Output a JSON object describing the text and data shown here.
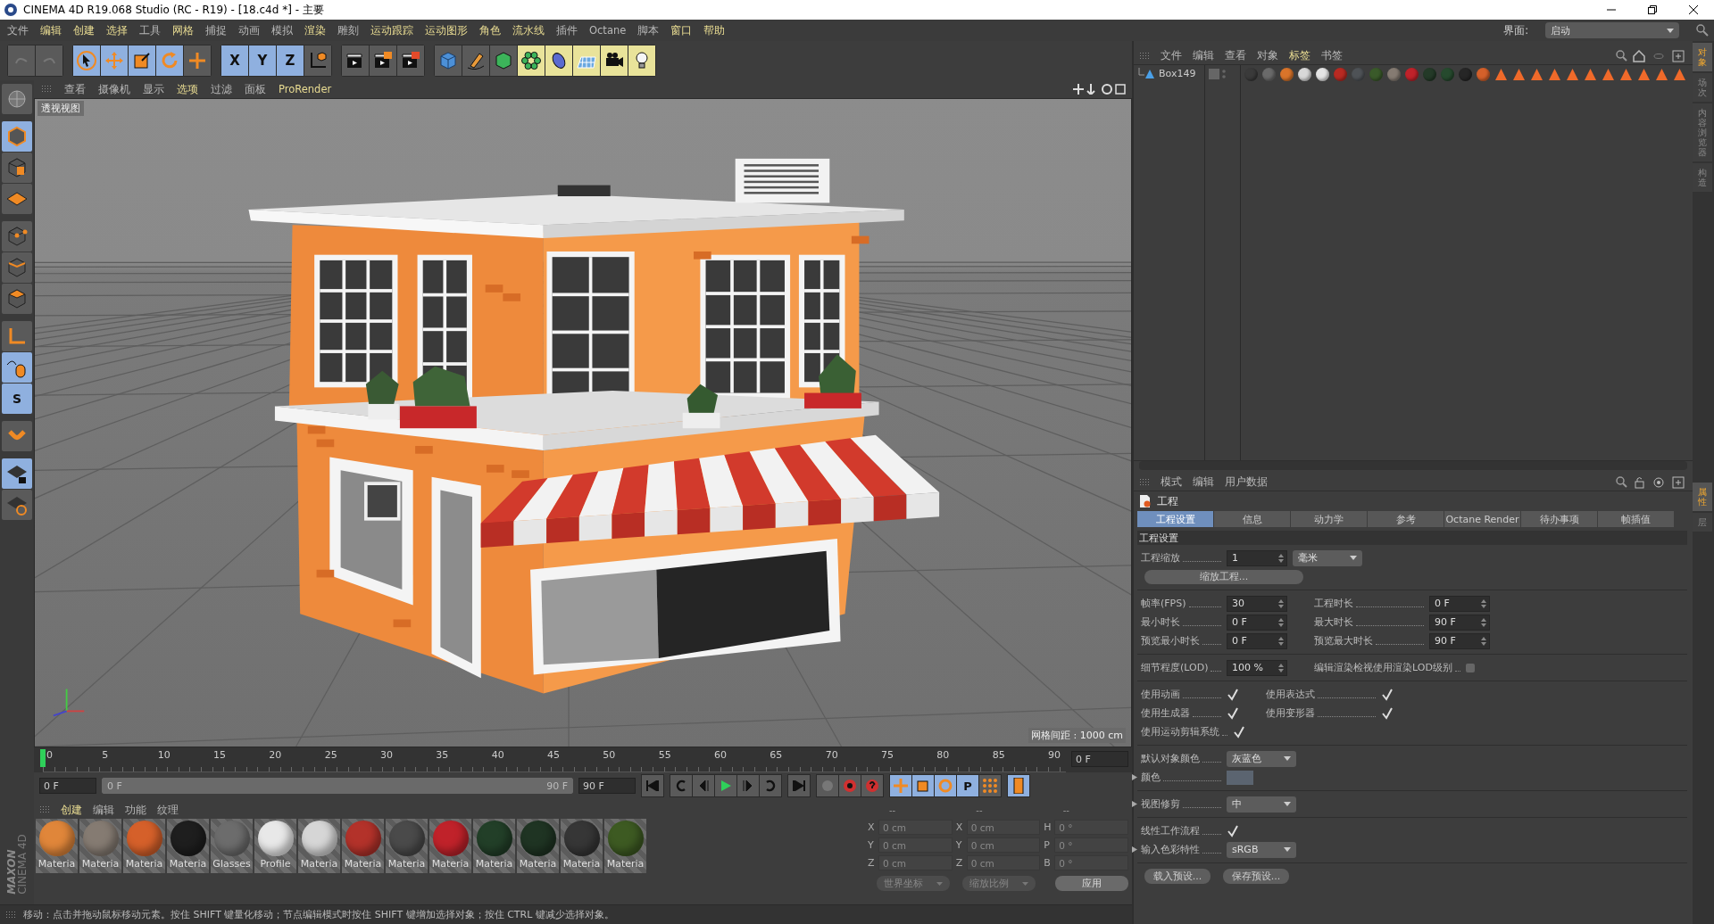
{
  "window": {
    "title": "CINEMA 4D R19.068 Studio (RC - R19) - [18.c4d *] - 主要"
  },
  "menu": [
    {
      "label": "文件",
      "highlighted": false
    },
    {
      "label": "编辑",
      "highlighted": true
    },
    {
      "label": "创建",
      "highlighted": true
    },
    {
      "label": "选择",
      "highlighted": true
    },
    {
      "label": "工具",
      "highlighted": false
    },
    {
      "label": "网格",
      "highlighted": true
    },
    {
      "label": "捕捉",
      "highlighted": false
    },
    {
      "label": "动画",
      "highlighted": false
    },
    {
      "label": "模拟",
      "highlighted": false
    },
    {
      "label": "渲染",
      "highlighted": true
    },
    {
      "label": "雕刻",
      "highlighted": false
    },
    {
      "label": "运动跟踪",
      "highlighted": true
    },
    {
      "label": "运动图形",
      "highlighted": true
    },
    {
      "label": "角色",
      "highlighted": true
    },
    {
      "label": "流水线",
      "highlighted": true
    },
    {
      "label": "插件",
      "highlighted": false
    },
    {
      "label": "Octane",
      "highlighted": false
    },
    {
      "label": "脚本",
      "highlighted": false
    },
    {
      "label": "窗口",
      "highlighted": true
    },
    {
      "label": "帮助",
      "highlighted": true
    }
  ],
  "interface": {
    "label": "界面:",
    "value": "启动"
  },
  "toolbar": [
    [
      {
        "kind": "undo",
        "active": false
      },
      {
        "kind": "redo",
        "active": false
      }
    ],
    [
      {
        "kind": "select",
        "active": true
      },
      {
        "kind": "move",
        "active": true
      },
      {
        "kind": "scale",
        "active": true
      },
      {
        "kind": "rotate",
        "active": true
      },
      {
        "kind": "transform",
        "active": false
      }
    ],
    [
      {
        "kind": "axis",
        "label": "X",
        "active": true
      },
      {
        "kind": "axis",
        "label": "Y",
        "active": true
      },
      {
        "kind": "axis",
        "label": "Z",
        "active": true
      },
      {
        "kind": "coords",
        "active": false
      }
    ],
    [
      {
        "kind": "render-view",
        "active": false
      },
      {
        "kind": "render-picture",
        "active": false
      },
      {
        "kind": "render-settings",
        "active": false
      }
    ],
    [
      {
        "kind": "cube",
        "active": false
      },
      {
        "kind": "pen",
        "active": false
      },
      {
        "kind": "subdivision",
        "active": false
      },
      {
        "kind": "cloner",
        "active": false
      },
      {
        "kind": "deformer",
        "active": false
      },
      {
        "kind": "floor",
        "active": false
      },
      {
        "kind": "camera",
        "active": false
      },
      {
        "kind": "light",
        "active": false
      }
    ]
  ],
  "left_tools": [
    [
      {
        "kind": "model",
        "active": false
      }
    ],
    [
      {
        "kind": "object",
        "active": true
      },
      {
        "kind": "texture",
        "active": false
      },
      {
        "kind": "workplane",
        "active": false
      }
    ],
    [
      {
        "kind": "points",
        "active": false
      },
      {
        "kind": "edges",
        "active": false
      },
      {
        "kind": "polygons",
        "active": false
      }
    ],
    [
      {
        "kind": "axis",
        "active": false
      },
      {
        "kind": "tweak",
        "active": true
      },
      {
        "kind": "solo",
        "label": "S",
        "active": true
      }
    ],
    [
      {
        "kind": "snap",
        "active": false
      }
    ],
    [
      {
        "kind": "lock-plane",
        "active": true
      },
      {
        "kind": "sync-plane",
        "active": false
      }
    ]
  ],
  "brand": [
    "MAXON",
    "CINEMA 4D"
  ],
  "viewport": {
    "menu": [
      {
        "label": "查看",
        "highlighted": false
      },
      {
        "label": "摄像机",
        "highlighted": false
      },
      {
        "label": "显示",
        "highlighted": false
      },
      {
        "label": "选项",
        "highlighted": true
      },
      {
        "label": "过滤",
        "highlighted": false
      },
      {
        "label": "面板",
        "highlighted": false
      },
      {
        "label": "ProRender",
        "highlighted": true
      }
    ],
    "view_label": "透视视图",
    "grid_label": "网格间距 : 1000 cm"
  },
  "timeline": {
    "ticks": [
      "0",
      "5",
      "10",
      "15",
      "20",
      "25",
      "30",
      "35",
      "40",
      "45",
      "50",
      "55",
      "60",
      "65",
      "70",
      "75",
      "80",
      "85",
      "90"
    ],
    "level": 0,
    "current": "0 F",
    "start": "0 F",
    "preview_range": {
      "start": "0 F",
      "end": "90 F",
      "level": 1
    },
    "end": "90 F"
  },
  "key_modes": [
    {
      "kind": "move",
      "active": true
    },
    {
      "kind": "scale",
      "active": true
    },
    {
      "kind": "rotate",
      "active": true
    },
    {
      "kind": "param",
      "label": "P",
      "active": true
    },
    {
      "kind": "pla",
      "active": false
    }
  ],
  "materials": {
    "menu": [
      {
        "label": "创建",
        "highlighted": true
      },
      {
        "label": "编辑",
        "highlighted": false
      },
      {
        "label": "功能",
        "highlighted": false
      },
      {
        "label": "纹理",
        "highlighted": false
      }
    ],
    "items": [
      {
        "name": "Materia",
        "color": "#e0863a"
      },
      {
        "name": "Materia",
        "color": "#857b72"
      },
      {
        "name": "Materia",
        "color": "#d5602a"
      },
      {
        "name": "Materia",
        "color": "#1e1e1e"
      },
      {
        "name": "Glasses",
        "color": "#6c6c6c"
      },
      {
        "name": "Profile",
        "color": "#e8e8e8"
      },
      {
        "name": "Materia",
        "color": "#d6d6d6"
      },
      {
        "name": "Materia",
        "color": "#b3322a"
      },
      {
        "name": "Materia",
        "color": "#4a4a4a"
      },
      {
        "name": "Materia",
        "color": "#c0222a"
      },
      {
        "name": "Materia",
        "color": "#223f28"
      },
      {
        "name": "Materia",
        "color": "#1f3423"
      },
      {
        "name": "Materia",
        "color": "#363636"
      },
      {
        "name": "Materia",
        "color": "#3d5a22"
      }
    ]
  },
  "coordinates": {
    "headers": [
      "--",
      "--",
      "--"
    ],
    "rows": [
      [
        {
          "axis": "X",
          "placeholder": "0 cm"
        },
        {
          "axis": "X",
          "placeholder": "0 cm"
        },
        {
          "axis": "H",
          "placeholder": "0 °"
        }
      ],
      [
        {
          "axis": "Y",
          "placeholder": "0 cm"
        },
        {
          "axis": "Y",
          "placeholder": "0 cm"
        },
        {
          "axis": "P",
          "placeholder": "0 °"
        }
      ],
      [
        {
          "axis": "Z",
          "placeholder": "0 cm"
        },
        {
          "axis": "Z",
          "placeholder": "0 cm"
        },
        {
          "axis": "B",
          "placeholder": "0 °"
        }
      ]
    ],
    "dropdowns": [
      "世界坐标",
      "缩放比例"
    ],
    "apply": "应用"
  },
  "status": "移动：点击并拖动鼠标移动元素。按住 SHIFT 键量化移动；节点编辑模式时按住 SHIFT 键增加选择对象；按住 CTRL 键减少选择对象。",
  "object_manager": {
    "menu": [
      {
        "label": "文件",
        "highlighted": false
      },
      {
        "label": "编辑",
        "highlighted": false
      },
      {
        "label": "查看",
        "highlighted": false
      },
      {
        "label": "对象",
        "highlighted": false
      },
      {
        "label": "标签",
        "highlighted": true
      },
      {
        "label": "书签",
        "highlighted": false
      }
    ],
    "objects": [
      {
        "name": "Box149",
        "tags": [
          {
            "kind": "material",
            "color": "#3a3a3a"
          },
          {
            "kind": "material",
            "color": "#6a6a6a"
          },
          {
            "kind": "material",
            "color": "#d9742a"
          },
          {
            "kind": "material",
            "color": "#d8d8d8"
          },
          {
            "kind": "material",
            "color": "#e4e4e4"
          },
          {
            "kind": "material",
            "color": "#b82a22"
          },
          {
            "kind": "material",
            "color": "#4e5256"
          },
          {
            "kind": "material",
            "color": "#3a5a2a"
          },
          {
            "kind": "material",
            "color": "#857b72"
          },
          {
            "kind": "material",
            "color": "#c0222a"
          },
          {
            "kind": "material",
            "color": "#243a28"
          },
          {
            "kind": "material",
            "color": "#264a2e"
          },
          {
            "kind": "material",
            "color": "#262626"
          },
          {
            "kind": "material",
            "color": "#d5602a"
          },
          {
            "kind": "triangle"
          },
          {
            "kind": "triangle"
          },
          {
            "kind": "triangle"
          },
          {
            "kind": "triangle"
          },
          {
            "kind": "triangle"
          },
          {
            "kind": "triangle"
          },
          {
            "kind": "triangle"
          },
          {
            "kind": "triangle"
          },
          {
            "kind": "triangle"
          },
          {
            "kind": "triangle"
          },
          {
            "kind": "triangle"
          }
        ]
      }
    ]
  },
  "attributes": {
    "menu": [
      {
        "label": "模式",
        "highlighted": false
      },
      {
        "label": "编辑",
        "highlighted": false
      },
      {
        "label": "用户数据",
        "highlighted": false
      }
    ],
    "title": "工程",
    "tabs": [
      {
        "label": "工程设置",
        "selected": true
      },
      {
        "label": "信息",
        "selected": false
      },
      {
        "label": "动力学",
        "selected": false
      },
      {
        "label": "参考",
        "selected": false
      },
      {
        "label": "Octane Render",
        "selected": false
      },
      {
        "label": "待办事项",
        "selected": false
      },
      {
        "label": "帧插值",
        "selected": false
      }
    ],
    "section": "工程设置",
    "groups": [
      [
        {
          "items": [
            {
              "label": "工程缩放",
              "kind": "number",
              "value": "1"
            },
            {
              "kind": "dropdown",
              "value": "毫米"
            }
          ]
        },
        {
          "items": [
            {
              "kind": "button",
              "value": "缩放工程..."
            }
          ]
        }
      ],
      [
        {
          "items": [
            {
              "label": "帧率(FPS)",
              "kind": "number",
              "value": "30"
            },
            {
              "label": "工程时长",
              "kind": "number",
              "value": "0 F"
            }
          ]
        },
        {
          "items": [
            {
              "label": "最小时长",
              "kind": "number",
              "value": "0 F"
            },
            {
              "label": "最大时长",
              "kind": "number",
              "value": "90 F"
            }
          ]
        },
        {
          "items": [
            {
              "label": "预览最小时长",
              "kind": "number",
              "value": "0 F"
            },
            {
              "label": "预览最大时长",
              "kind": "number",
              "value": "90 F"
            }
          ]
        }
      ],
      [
        {
          "items": [
            {
              "label": "细节程度(LOD)",
              "kind": "number",
              "value": "100 %"
            },
            {
              "label": "编辑渲染检视使用渲染LOD级别",
              "kind": "checkbox",
              "checked": false
            }
          ]
        }
      ],
      [
        {
          "items": [
            {
              "label": "使用动画",
              "kind": "checkbox",
              "checked": true
            },
            {
              "label": "使用表达式",
              "kind": "checkbox",
              "checked": true
            }
          ]
        },
        {
          "items": [
            {
              "label": "使用生成器",
              "kind": "checkbox",
              "checked": true
            },
            {
              "label": "使用变形器",
              "kind": "checkbox",
              "checked": true
            }
          ]
        },
        {
          "items": [
            {
              "label": "使用运动剪辑系统",
              "kind": "checkbox",
              "checked": true
            }
          ]
        }
      ],
      [
        {
          "items": [
            {
              "label": "默认对象颜色",
              "kind": "dropdown",
              "value": "灰蓝色"
            }
          ]
        },
        {
          "items": [
            {
              "label": "颜色",
              "kind": "swatch",
              "color": "#5b6470",
              "expanded": false
            }
          ]
        }
      ],
      [
        {
          "items": [
            {
              "label": "视图修剪",
              "kind": "dropdown",
              "value": "中",
              "expanded": false
            }
          ]
        }
      ],
      [
        {
          "items": [
            {
              "label": "线性工作流程",
              "kind": "checkbox",
              "checked": true
            }
          ]
        },
        {
          "items": [
            {
              "label": "输入色彩特性",
              "kind": "dropdown",
              "value": "sRGB",
              "expanded": false
            }
          ]
        }
      ]
    ],
    "buttons": [
      "载入预设...",
      "保存预设..."
    ]
  },
  "side_tabs": {
    "top": [
      {
        "label": "对象",
        "selected": true
      },
      {
        "label": "场次",
        "selected": false
      },
      {
        "label": "内容浏览器",
        "selected": false
      },
      {
        "label": "构造",
        "selected": false
      }
    ],
    "bottom": [
      {
        "label": "属性",
        "selected": true
      },
      {
        "label": "层",
        "selected": false
      }
    ]
  }
}
